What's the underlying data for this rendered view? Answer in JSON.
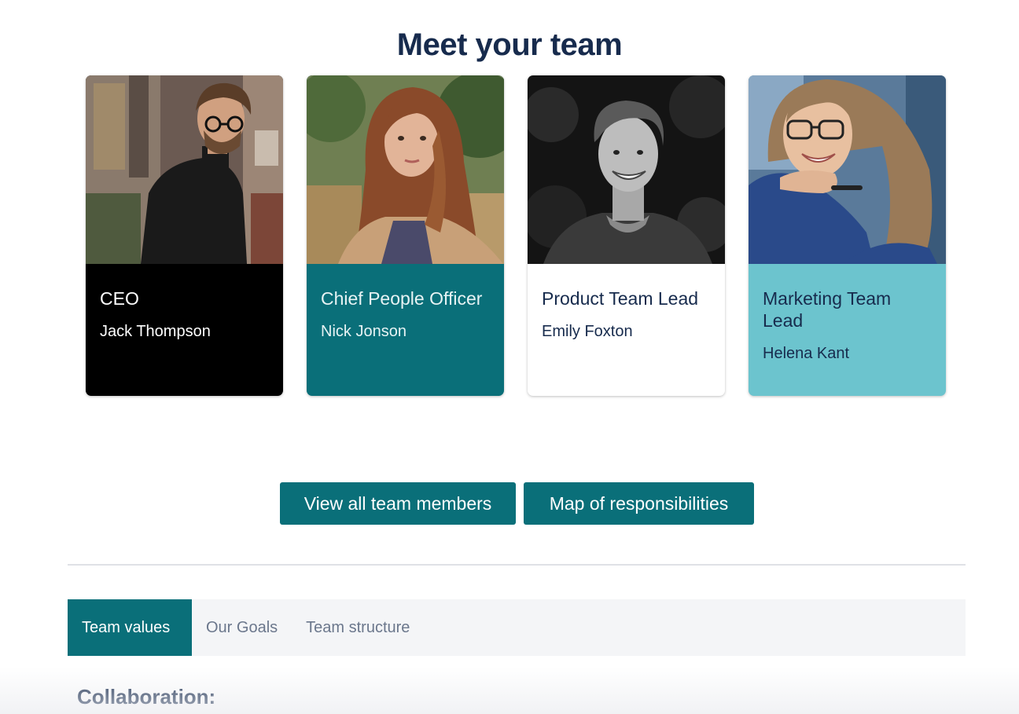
{
  "page": {
    "title": "Meet your team"
  },
  "team": [
    {
      "role": "CEO",
      "name": "Jack Thompson",
      "photo": "man-black-turtleneck-glasses"
    },
    {
      "role": "Chief People Officer",
      "name": "Nick Jonson",
      "photo": "woman-auburn-hair"
    },
    {
      "role": "Product Team Lead",
      "name": "Emily Foxton",
      "photo": "smiling-young-man-grayscale"
    },
    {
      "role": "Marketing Team Lead",
      "name": "Helena Kant",
      "photo": "smiling-woman-glasses"
    }
  ],
  "actions": {
    "view_all_label": "View all team members",
    "map_label": "Map of responsibilities"
  },
  "tabs": [
    {
      "label": "Team values",
      "active": true
    },
    {
      "label": "Our Goals",
      "active": false
    },
    {
      "label": "Team structure",
      "active": false
    }
  ],
  "content": {
    "heading": "Collaboration:"
  },
  "colors": {
    "accent": "#0a6f79",
    "light_accent": "#6cc4ce",
    "heading": "#172b4d"
  }
}
